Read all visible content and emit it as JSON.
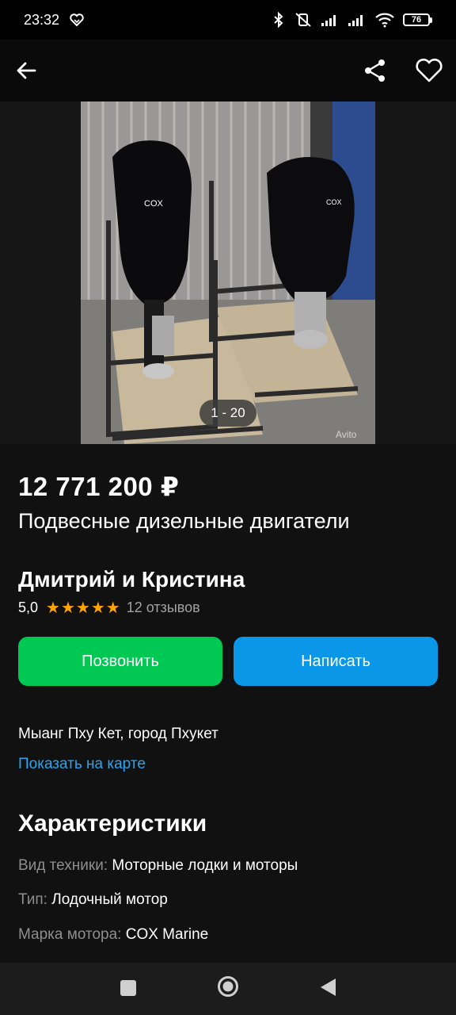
{
  "status_bar": {
    "time": "23:32",
    "battery": "76",
    "icons": [
      "bluetooth-icon",
      "vibrate-off-icon",
      "signal-icon",
      "signal-icon",
      "wifi-icon",
      "battery-icon"
    ]
  },
  "topbar": {
    "icons": [
      "back-arrow-icon",
      "share-icon",
      "heart-icon"
    ]
  },
  "gallery": {
    "counter": "1 - 20",
    "watermark": "Avito"
  },
  "listing": {
    "price": "12 771 200 ₽",
    "title": "Подвесные дизельные двигатели"
  },
  "seller": {
    "name": "Дмитрий и Кристина",
    "rating": "5,0",
    "stars": 5,
    "reviews": "12 отзывов"
  },
  "actions": {
    "call_label": "Позвонить",
    "write_label": "Написать"
  },
  "location": {
    "address": "Мыанг Пху Кет, город Пхукет",
    "map_link": "Показать на карте"
  },
  "characteristics": {
    "title": "Характеристики",
    "items": [
      {
        "key": "Вид техники:",
        "value": "Моторные лодки и моторы"
      },
      {
        "key": "Тип:",
        "value": "Лодочный мотор"
      },
      {
        "key": "Марка мотора:",
        "value": "COX Marine"
      }
    ]
  },
  "colors": {
    "accent_green": "#00c853",
    "accent_blue": "#0a97e8",
    "link_blue": "#2aa5f0",
    "star": "#ffa400",
    "background": "#111111"
  }
}
